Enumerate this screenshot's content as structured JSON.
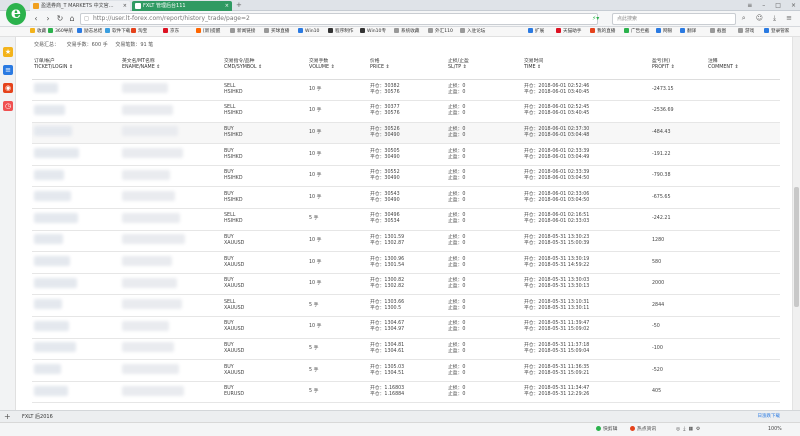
{
  "browser": {
    "tabs": [
      {
        "label": "盈透券商_T MARKETS 中文官…",
        "active": false
      },
      {
        "label": "FXLT 管理后台111",
        "active": true
      }
    ],
    "url": "http://user.lt-forex.com/report/history_trade/page=2",
    "search_placeholder": "点此搜索",
    "colors": {
      "brand_green": "#2bb24c",
      "active_tab": "#2f9a62"
    }
  },
  "bookmarks": [
    {
      "label": "收藏"
    },
    {
      "label": "360导航"
    },
    {
      "label": "励志总结"
    },
    {
      "label": "软件下载"
    },
    {
      "label": "淘宝"
    },
    {
      "label": "京东"
    },
    {
      "label": "[新]提醒"
    },
    {
      "label": "新闻链接"
    },
    {
      "label": "买球直播"
    },
    {
      "label": "Win10"
    },
    {
      "label": "程序制作"
    },
    {
      "label": "Win10专"
    },
    {
      "label": "系统收藏"
    },
    {
      "label": "外汇110"
    },
    {
      "label": "入驻论坛"
    }
  ],
  "bookmarks_right": [
    {
      "label": "扩展"
    },
    {
      "label": "天猫助手"
    },
    {
      "label": "我的直播"
    },
    {
      "label": "广告拦截"
    },
    {
      "label": "网银"
    },
    {
      "label": "翻译"
    },
    {
      "label": "截图"
    },
    {
      "label": "游戏"
    },
    {
      "label": "登录管家"
    }
  ],
  "summary": {
    "lots_label": "交易汇总：",
    "total_lots": "交易手数：600 手",
    "total_count": "交易笔数：91 笔"
  },
  "table": {
    "headers": [
      {
        "cn": "订单/帐户",
        "en": "TICKET/LOGIN ⇕"
      },
      {
        "cn": "英文名/MT名称",
        "en": "ENAME/NAME ⇕"
      },
      {
        "cn": "交易指令/品种",
        "en": "CMD/SYMBOL ⇕"
      },
      {
        "cn": "交易手数",
        "en": "VOLUME ⇕"
      },
      {
        "cn": "价格",
        "en": "PRICE ⇕"
      },
      {
        "cn": "止损/止盈",
        "en": "SL/TP ⇕"
      },
      {
        "cn": "交易时间",
        "en": "TIME ⇕"
      },
      {
        "cn": "盈亏(利)",
        "en": "PROFIT ⇕"
      },
      {
        "cn": "注释",
        "en": "COMMENT ⇕"
      }
    ],
    "rows": [
      {
        "cmd": "SELL",
        "symbol": "HSIHKD",
        "volume": "10 手",
        "open": "开仓：30382",
        "close": "平仓：30576",
        "sl": "止损：0",
        "tp": "止盈：0",
        "t_open": "开仓：2018-06-01 02:52:46",
        "t_close": "平仓：2018-06-01 03:40:45",
        "profit": "-2473.15",
        "sign": "neg"
      },
      {
        "cmd": "SELL",
        "symbol": "HSIHKD",
        "volume": "10 手",
        "open": "开仓：30377",
        "close": "平仓：30576",
        "sl": "止损：0",
        "tp": "止盈：0",
        "t_open": "开仓：2018-06-01 02:52:45",
        "t_close": "平仓：2018-06-01 03:40:45",
        "profit": "-2536.69",
        "sign": "neg"
      },
      {
        "cmd": "BUY",
        "symbol": "HSIHKD",
        "volume": "10 手",
        "open": "开仓：30526",
        "close": "平仓：30490",
        "sl": "止损：0",
        "tp": "止盈：0",
        "t_open": "开仓：2018-06-01 02:37:30",
        "t_close": "平仓：2018-06-01 03:04:48",
        "profit": "-484.43",
        "sign": "neg"
      },
      {
        "cmd": "BUY",
        "symbol": "HSIHKD",
        "volume": "10 手",
        "open": "开仓：30505",
        "close": "平仓：30490",
        "sl": "止损：0",
        "tp": "止盈：0",
        "t_open": "开仓：2018-06-01 02:33:39",
        "t_close": "平仓：2018-06-01 03:04:49",
        "profit": "-191.22",
        "sign": "neg"
      },
      {
        "cmd": "BUY",
        "symbol": "HSIHKD",
        "volume": "10 手",
        "open": "开仓：30552",
        "close": "平仓：30490",
        "sl": "止损：0",
        "tp": "止盈：0",
        "t_open": "开仓：2018-06-01 02:33:39",
        "t_close": "平仓：2018-06-01 03:04:50",
        "profit": "-790.38",
        "sign": "neg"
      },
      {
        "cmd": "BUY",
        "symbol": "HSIHKD",
        "volume": "10 手",
        "open": "开仓：30543",
        "close": "平仓：30490",
        "sl": "止损：0",
        "tp": "止盈：0",
        "t_open": "开仓：2018-06-01 02:33:06",
        "t_close": "平仓：2018-06-01 03:04:50",
        "profit": "-675.65",
        "sign": "neg"
      },
      {
        "cmd": "SELL",
        "symbol": "HSIHKD",
        "volume": "5 手",
        "open": "开仓：30496",
        "close": "平仓：30534",
        "sl": "止损：0",
        "tp": "止盈：0",
        "t_open": "开仓：2018-06-01 02:16:51",
        "t_close": "平仓：2018-06-01 02:33:03",
        "profit": "-242.21",
        "sign": "neg"
      },
      {
        "cmd": "BUY",
        "symbol": "XAUUSD",
        "volume": "10 手",
        "open": "开仓：1301.59",
        "close": "平仓：1302.87",
        "sl": "止损：0",
        "tp": "止盈：0",
        "t_open": "开仓：2018-05-31 13:30:23",
        "t_close": "平仓：2018-05-31 15:00:39",
        "profit": "1280",
        "sign": "pos"
      },
      {
        "cmd": "BUY",
        "symbol": "XAUUSD",
        "volume": "10 手",
        "open": "开仓：1300.96",
        "close": "平仓：1301.54",
        "sl": "止损：0",
        "tp": "止盈：0",
        "t_open": "开仓：2018-05-31 13:30:19",
        "t_close": "平仓：2018-05-31 14:59:22",
        "profit": "580",
        "sign": "pos"
      },
      {
        "cmd": "BUY",
        "symbol": "XAUUSD",
        "volume": "10 手",
        "open": "开仓：1300.82",
        "close": "平仓：1302.82",
        "sl": "止损：0",
        "tp": "止盈：0",
        "t_open": "开仓：2018-05-31 13:30:03",
        "t_close": "平仓：2018-05-31 13:30:13",
        "profit": "2000",
        "sign": "pos"
      },
      {
        "cmd": "SELL",
        "symbol": "XAUUSD",
        "volume": "5 手",
        "open": "开仓：1303.66",
        "close": "平仓：1300.5",
        "sl": "止损：0",
        "tp": "止盈：0",
        "t_open": "开仓：2018-05-31 13:10:31",
        "t_close": "平仓：2018-05-31 13:30:11",
        "profit": "2844",
        "sign": "pos"
      },
      {
        "cmd": "BUY",
        "symbol": "XAUUSD",
        "volume": "10 手",
        "open": "开仓：1304.67",
        "close": "平仓：1304.97",
        "sl": "止损：0",
        "tp": "止盈：0",
        "t_open": "开仓：2018-05-31 11:39:47",
        "t_close": "平仓：2018-05-31 15:09:02",
        "profit": "-50",
        "sign": "neg"
      },
      {
        "cmd": "BUY",
        "symbol": "XAUUSD",
        "volume": "5 手",
        "open": "开仓：1304.81",
        "close": "平仓：1304.61",
        "sl": "止损：0",
        "tp": "止盈：0",
        "t_open": "开仓：2018-05-31 11:37:18",
        "t_close": "平仓：2018-05-31 15:09:04",
        "profit": "-100",
        "sign": "neg"
      },
      {
        "cmd": "BUY",
        "symbol": "XAUUSD",
        "volume": "5 手",
        "open": "开仓：1305.03",
        "close": "平仓：1304.51",
        "sl": "止损：0",
        "tp": "止盈：0",
        "t_open": "开仓：2018-05-31 11:36:35",
        "t_close": "平仓：2018-05-31 15:09:21",
        "profit": "-520",
        "sign": "neg"
      },
      {
        "cmd": "BUY",
        "symbol": "EURUSD",
        "volume": "5 手",
        "open": "开仓：1.16803",
        "close": "平仓：1.16884",
        "sl": "止损：0",
        "tp": "止盈：0",
        "t_open": "开仓：2018-05-31 11:34:47",
        "t_close": "平仓：2018-05-31 12:29:26",
        "profit": "405",
        "sign": "pos"
      }
    ]
  },
  "bottom": {
    "tab_label": "FXLT 后2016",
    "right_hint": "日涨跌下载"
  },
  "status": [
    {
      "label": "快剪辑"
    },
    {
      "label": "热点资讯"
    }
  ],
  "zoom": "100%"
}
